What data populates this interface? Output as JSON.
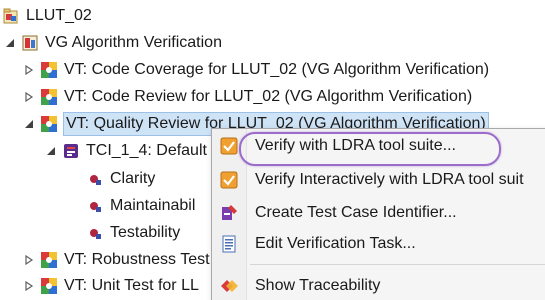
{
  "tree": {
    "project": {
      "label": "LLUT_02",
      "icon": "project-folder-icon"
    },
    "vg_algorithm": {
      "label": "VG Algorithm Verification",
      "icon": "verification-group-icon"
    },
    "vt_code_coverage": {
      "label": "VT: Code Coverage for LLUT_02 (VG Algorithm Verification)",
      "icon": "verification-task-icon"
    },
    "vt_code_review": {
      "label": "VT: Code Review for LLUT_02 (VG Algorithm Verification)",
      "icon": "verification-task-icon"
    },
    "vt_quality_review": {
      "label": "VT: Quality Review for LLUT_02 (VG Algorithm Verification)",
      "icon": "verification-task-icon"
    },
    "tci": {
      "label": "TCI_1_4: Default",
      "icon": "test-case-identifier-icon"
    },
    "clarity": {
      "label": "Clarity",
      "icon": "attribute-bullet-icon"
    },
    "maintainability": {
      "label": "Maintainabil",
      "icon": "attribute-bullet-icon"
    },
    "testability": {
      "label": "Testability",
      "icon": "attribute-bullet-icon"
    },
    "vt_robustness": {
      "label": "VT: Robustness Test",
      "icon": "verification-task-icon"
    },
    "vt_unit_test": {
      "label": "VT: Unit Test for LL",
      "icon": "verification-task-icon"
    }
  },
  "context_menu": {
    "items": [
      {
        "label": "Verify with LDRA tool suite...",
        "icon": "verify-check-icon"
      },
      {
        "label": "Verify Interactively with LDRA tool suit",
        "icon": "verify-interactive-icon"
      },
      {
        "label": "Create Test Case Identifier...",
        "icon": "create-tci-icon"
      },
      {
        "label": "Edit Verification Task...",
        "icon": "edit-task-icon"
      },
      {
        "label": "Show Traceability",
        "icon": "traceability-icon"
      }
    ]
  },
  "colors": {
    "highlight_oval": "#9b6cc9",
    "selection": "#cfe3f7"
  }
}
